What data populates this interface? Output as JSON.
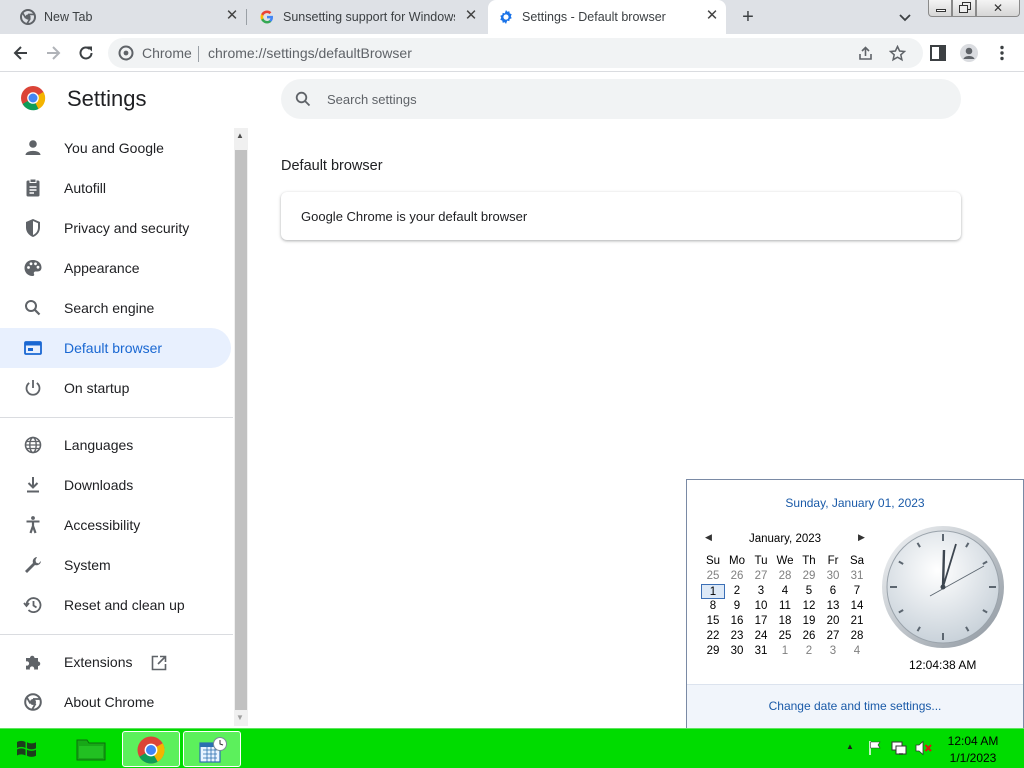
{
  "tabs": [
    {
      "title": "New Tab",
      "icon": "chrome-icon"
    },
    {
      "title": "Sunsetting support for Windows",
      "icon": "google-g-icon"
    },
    {
      "title": "Settings - Default browser",
      "icon": "gear-icon"
    }
  ],
  "omnibox": {
    "site": "Chrome",
    "url": "chrome://settings/defaultBrowser"
  },
  "settings": {
    "title": "Settings",
    "search_placeholder": "Search settings",
    "nav": [
      {
        "label": "You and Google",
        "icon": "person-icon"
      },
      {
        "label": "Autofill",
        "icon": "clipboard-icon"
      },
      {
        "label": "Privacy and security",
        "icon": "shield-icon"
      },
      {
        "label": "Appearance",
        "icon": "palette-icon"
      },
      {
        "label": "Search engine",
        "icon": "search-icon"
      },
      {
        "label": "Default browser",
        "icon": "browser-window-icon",
        "selected": true
      },
      {
        "label": "On startup",
        "icon": "power-icon"
      },
      {
        "label": "Languages",
        "icon": "globe-icon"
      },
      {
        "label": "Downloads",
        "icon": "download-icon"
      },
      {
        "label": "Accessibility",
        "icon": "accessibility-icon"
      },
      {
        "label": "System",
        "icon": "wrench-icon"
      },
      {
        "label": "Reset and clean up",
        "icon": "history-icon"
      },
      {
        "label": "Extensions",
        "icon": "puzzle-icon"
      },
      {
        "label": "About Chrome",
        "icon": "chrome-icon"
      }
    ],
    "section_title": "Default browser",
    "card_text": "Google Chrome is your default browser"
  },
  "calendar": {
    "date_link": "Sunday, January 01, 2023",
    "month": "January, 2023",
    "weekdays": [
      "Su",
      "Mo",
      "Tu",
      "We",
      "Th",
      "Fr",
      "Sa"
    ],
    "weeks": [
      [
        "25",
        "26",
        "27",
        "28",
        "29",
        "30",
        "31"
      ],
      [
        "1",
        "2",
        "3",
        "4",
        "5",
        "6",
        "7"
      ],
      [
        "8",
        "9",
        "10",
        "11",
        "12",
        "13",
        "14"
      ],
      [
        "15",
        "16",
        "17",
        "18",
        "19",
        "20",
        "21"
      ],
      [
        "22",
        "23",
        "24",
        "25",
        "26",
        "27",
        "28"
      ],
      [
        "29",
        "30",
        "31",
        "1",
        "2",
        "3",
        "4"
      ]
    ],
    "time": "12:04:38 AM",
    "change_link": "Change date and time settings..."
  },
  "taskbar": {
    "time": "12:04 AM",
    "date": "1/1/2023",
    "color": "#00dc00"
  }
}
